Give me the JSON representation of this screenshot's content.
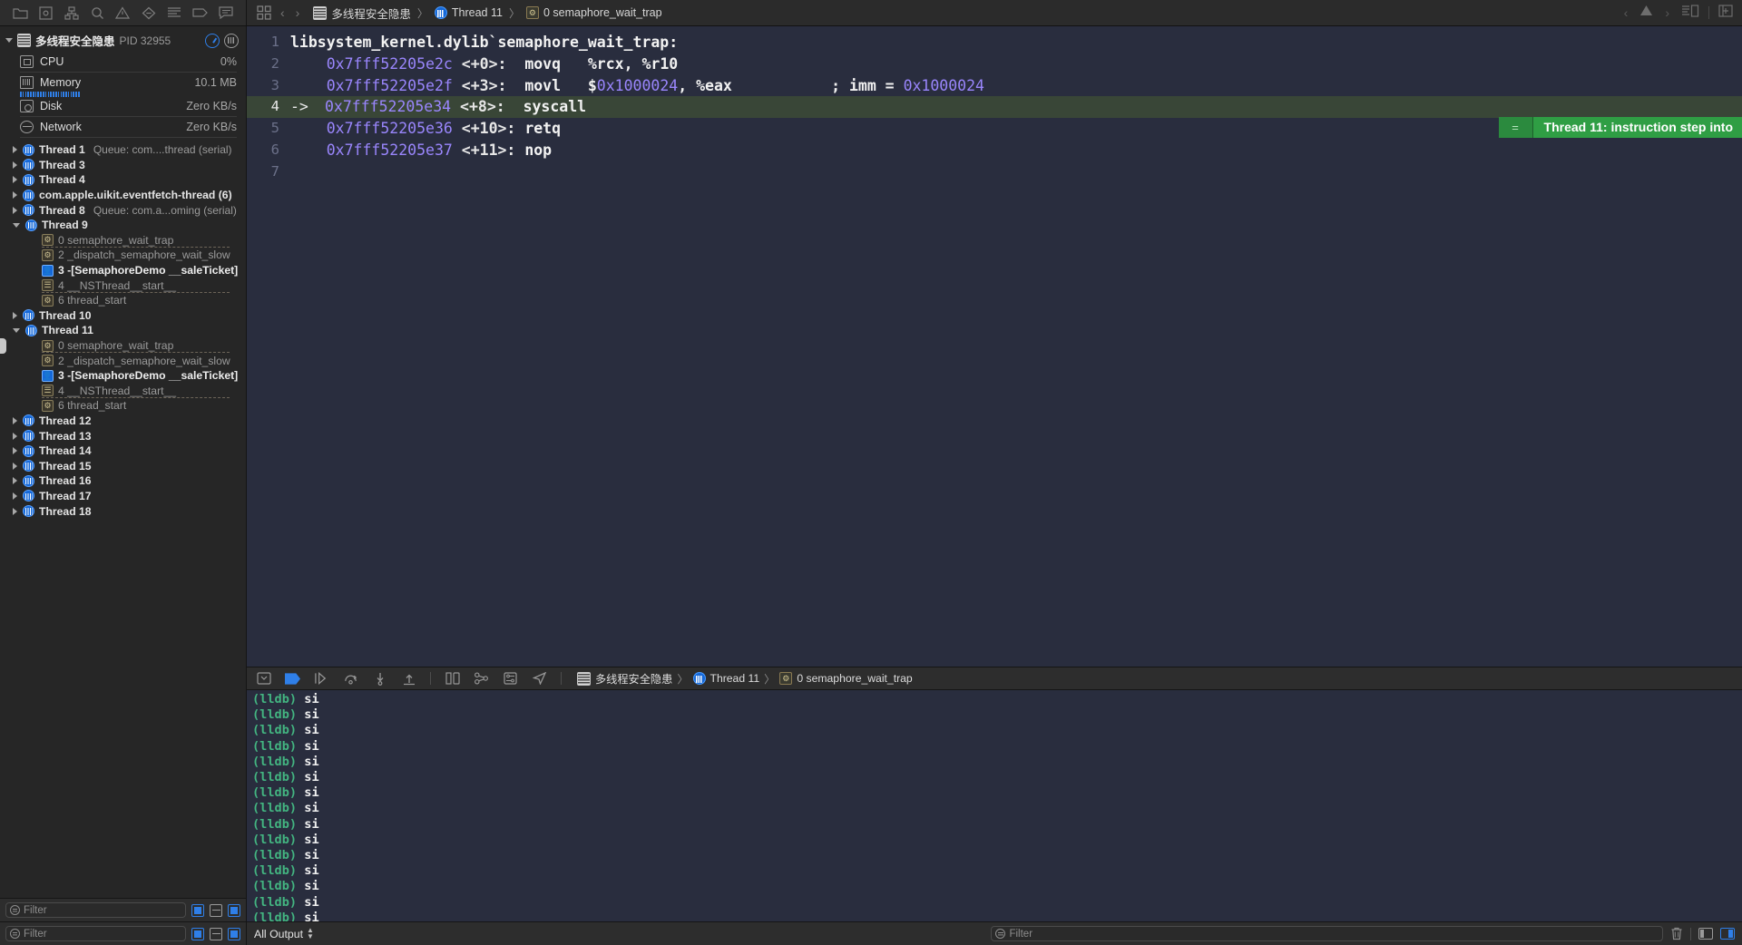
{
  "toolbar": {
    "nav_icons": [
      "folder-icon",
      "source-control-icon",
      "symbol-hierarchy-icon",
      "search-icon",
      "warning-icon",
      "breakpoint-icon",
      "report-icon",
      "tag-icon",
      "comment-icon"
    ],
    "grid_icon": "grid-icon",
    "back_label": "‹",
    "forward_label": "›",
    "jumpbar": {
      "project": "多线程安全隐患",
      "thread": "Thread 11",
      "frame": "0 semaphore_wait_trap",
      "separator": "〉"
    },
    "right_icons": [
      "chevron-left-icon",
      "warning-triangle-icon",
      "chevron-right-icon",
      "editor-options-icon",
      "add-editor-icon"
    ]
  },
  "sidebar": {
    "process": {
      "name": "多线程安全隐患",
      "pid_label": "PID 32955",
      "gauge_button": "gauge-icon",
      "threads_button": "threads-icon"
    },
    "stats": [
      {
        "label": "CPU",
        "value": "0%",
        "icon": "cpu-icon"
      },
      {
        "label": "Memory",
        "value": "10.1 MB",
        "icon": "memory-icon"
      },
      {
        "label": "Disk",
        "value": "Zero KB/s",
        "icon": "disk-icon"
      },
      {
        "label": "Network",
        "value": "Zero KB/s",
        "icon": "network-icon"
      }
    ],
    "threads": [
      {
        "label": "Thread 1",
        "queue": "Queue: com....thread (serial)",
        "expanded": false
      },
      {
        "label": "Thread 3",
        "queue": "",
        "expanded": false
      },
      {
        "label": "Thread 4",
        "queue": "",
        "expanded": false
      },
      {
        "label": "com.apple.uikit.eventfetch-thread (6)",
        "queue": "",
        "expanded": false
      },
      {
        "label": "Thread 8",
        "queue": "Queue: com.a...oming (serial)",
        "expanded": false
      },
      {
        "label": "Thread 9",
        "queue": "",
        "expanded": true,
        "frames": [
          {
            "label": "0 semaphore_wait_trap",
            "kind": "sys",
            "dashed": true
          },
          {
            "label": "2 _dispatch_semaphore_wait_slow",
            "kind": "sys",
            "dashed": false
          },
          {
            "label": "3 -[SemaphoreDemo __saleTicket]",
            "kind": "user",
            "dashed": false
          },
          {
            "label": "4 __NSThread__start__",
            "kind": "lib",
            "dashed": true
          },
          {
            "label": "6 thread_start",
            "kind": "sys",
            "dashed": false
          }
        ]
      },
      {
        "label": "Thread 10",
        "queue": "",
        "expanded": false
      },
      {
        "label": "Thread 11",
        "queue": "",
        "expanded": true,
        "selected_tab": true,
        "frames": [
          {
            "label": "0 semaphore_wait_trap",
            "kind": "sys",
            "dashed": true
          },
          {
            "label": "2 _dispatch_semaphore_wait_slow",
            "kind": "sys",
            "dashed": false
          },
          {
            "label": "3 -[SemaphoreDemo __saleTicket]",
            "kind": "user",
            "dashed": false
          },
          {
            "label": "4 __NSThread__start__",
            "kind": "lib",
            "dashed": true
          },
          {
            "label": "6 thread_start",
            "kind": "sys",
            "dashed": false
          }
        ]
      },
      {
        "label": "Thread 12",
        "queue": "",
        "expanded": false
      },
      {
        "label": "Thread 13",
        "queue": "",
        "expanded": false
      },
      {
        "label": "Thread 14",
        "queue": "",
        "expanded": false
      },
      {
        "label": "Thread 15",
        "queue": "",
        "expanded": false
      },
      {
        "label": "Thread 16",
        "queue": "",
        "expanded": false
      },
      {
        "label": "Thread 17",
        "queue": "",
        "expanded": false
      },
      {
        "label": "Thread 18",
        "queue": "",
        "expanded": false
      }
    ],
    "filter": {
      "placeholder": "Filter",
      "buttons": [
        "show-only-crashed-icon",
        "show-only-running-icon",
        "show-only-stack-icon"
      ]
    }
  },
  "editor": {
    "lines": [
      {
        "num": "1",
        "arrow": "",
        "current": false,
        "segments": [
          {
            "text": "libsystem_kernel.dylib`semaphore_wait_trap:",
            "cls": "mnem"
          }
        ]
      },
      {
        "num": "2",
        "arrow": "",
        "current": false,
        "segments": [
          {
            "text": "    ",
            "cls": "mnem"
          },
          {
            "text": "0x7fff52205e2c ",
            "cls": "addr"
          },
          {
            "text": "<+0>:  ",
            "cls": "off"
          },
          {
            "text": "movq   %rcx, %r10",
            "cls": "mnem"
          }
        ]
      },
      {
        "num": "3",
        "arrow": "",
        "current": false,
        "segments": [
          {
            "text": "    ",
            "cls": "mnem"
          },
          {
            "text": "0x7fff52205e2f ",
            "cls": "addr"
          },
          {
            "text": "<+3>:  ",
            "cls": "off"
          },
          {
            "text": "movl   $",
            "cls": "mnem"
          },
          {
            "text": "0x1000024",
            "cls": "num"
          },
          {
            "text": ", %eax           ; imm = ",
            "cls": "mnem"
          },
          {
            "text": "0x1000024",
            "cls": "num"
          }
        ]
      },
      {
        "num": "4",
        "arrow": "->",
        "current": true,
        "segments": [
          {
            "text": "0x7fff52205e34 ",
            "cls": "addr"
          },
          {
            "text": "<+8>:  ",
            "cls": "off"
          },
          {
            "text": "syscall",
            "cls": "mnem"
          }
        ]
      },
      {
        "num": "5",
        "arrow": "",
        "current": false,
        "segments": [
          {
            "text": "    ",
            "cls": "mnem"
          },
          {
            "text": "0x7fff52205e36 ",
            "cls": "addr"
          },
          {
            "text": "<+10>: ",
            "cls": "off"
          },
          {
            "text": "retq",
            "cls": "mnem"
          }
        ]
      },
      {
        "num": "6",
        "arrow": "",
        "current": false,
        "segments": [
          {
            "text": "    ",
            "cls": "mnem"
          },
          {
            "text": "0x7fff52205e37 ",
            "cls": "addr"
          },
          {
            "text": "<+11>: ",
            "cls": "off"
          },
          {
            "text": "nop",
            "cls": "mnem"
          }
        ]
      },
      {
        "num": "7",
        "arrow": "",
        "current": false,
        "segments": []
      }
    ],
    "banner": {
      "equals": "=",
      "message": "Thread 11: instruction step into"
    }
  },
  "debugbar": {
    "icons": [
      "hide-debug-area-icon",
      "breakpoint-activate-icon",
      "continue-icon",
      "step-over-icon",
      "step-into-icon",
      "step-out-icon",
      "debug-view-hierarchy-icon",
      "debug-memory-graph-icon",
      "environment-overrides-icon",
      "simulate-location-icon"
    ],
    "jumpbar": {
      "project": "多线程安全隐患",
      "thread": "Thread 11",
      "frame": "0 semaphore_wait_trap",
      "separator": "〉"
    }
  },
  "console": {
    "prompt": "(lldb)",
    "lines": [
      {
        "prompt": "(lldb)",
        "cmd": " si"
      },
      {
        "prompt": "(lldb)",
        "cmd": " si"
      },
      {
        "prompt": "(lldb)",
        "cmd": " si"
      },
      {
        "prompt": "(lldb)",
        "cmd": " si"
      },
      {
        "prompt": "(lldb)",
        "cmd": " si"
      },
      {
        "prompt": "(lldb)",
        "cmd": " si"
      },
      {
        "prompt": "(lldb)",
        "cmd": " si"
      },
      {
        "prompt": "(lldb)",
        "cmd": " si"
      },
      {
        "prompt": "(lldb)",
        "cmd": " si"
      },
      {
        "prompt": "(lldb)",
        "cmd": " si"
      },
      {
        "prompt": "(lldb)",
        "cmd": " si"
      },
      {
        "prompt": "(lldb)",
        "cmd": " si"
      },
      {
        "prompt": "(lldb)",
        "cmd": " si"
      },
      {
        "prompt": "(lldb)",
        "cmd": " si"
      },
      {
        "prompt": "(lldb)",
        "cmd": " si"
      },
      {
        "prompt": "(lldb)",
        "cmd": ""
      }
    ]
  },
  "bottombar": {
    "output_scope": "All Output",
    "console_filter_placeholder": "Filter",
    "trash_icon": "trash-icon",
    "left_pane_icon": "show-console-pane-icon",
    "right_pane_icon": "show-variables-pane-icon"
  },
  "colors": {
    "accent_blue": "#2f7fe8",
    "banner_green": "#2f9e44",
    "current_line": "#394637",
    "code_bg": "#292d3e",
    "addr_purple": "#9a86fd",
    "prompt_green": "#43b581"
  }
}
